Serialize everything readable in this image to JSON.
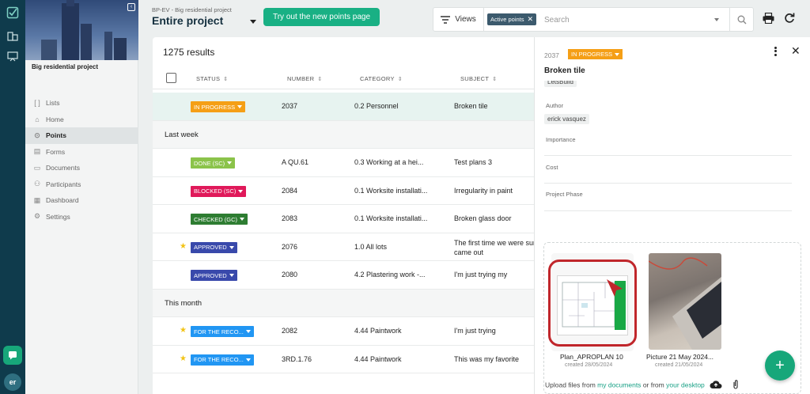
{
  "project": {
    "breadcrumb": "BP-EV - Big residential project",
    "title": "Entire project",
    "sidebar_name": "Big residential project"
  },
  "try_button": "Try out the new points page",
  "toolbar": {
    "views_label": "Views",
    "active_chip": "Active points",
    "search_placeholder": "Search"
  },
  "nav": [
    {
      "label": "Lists",
      "icon": "list-icon",
      "active": false
    },
    {
      "label": "Home",
      "icon": "home-icon",
      "active": false
    },
    {
      "label": "Points",
      "icon": "pin-icon",
      "active": true
    },
    {
      "label": "Forms",
      "icon": "form-icon",
      "active": false
    },
    {
      "label": "Documents",
      "icon": "folder-icon",
      "active": false
    },
    {
      "label": "Participants",
      "icon": "people-icon",
      "active": false
    },
    {
      "label": "Dashboard",
      "icon": "dashboard-icon",
      "active": false
    },
    {
      "label": "Settings",
      "icon": "gear-icon",
      "active": false
    }
  ],
  "rail": {
    "avatar_initials": "er"
  },
  "list": {
    "results": "1275 results",
    "headers": {
      "status": "STATUS",
      "number": "NUMBER",
      "category": "CATEGORY",
      "subject": "SUBJECT"
    },
    "rows": [
      {
        "type": "item",
        "selected": true,
        "star": false,
        "status": "IN PROGRESS",
        "color": "#f59f16",
        "number": "2037",
        "category": "0.2 Personnel",
        "subject": "Broken tile"
      },
      {
        "type": "group",
        "label": "Last week"
      },
      {
        "type": "item",
        "star": false,
        "status": "DONE (SC)",
        "color": "#8bc34a",
        "number": "A QU.61",
        "category": "0.3 Working at a hei...",
        "subject": "Test plans 3"
      },
      {
        "type": "item",
        "star": false,
        "status": "BLOCKED (SC)",
        "color": "#e0195a",
        "number": "2084",
        "category": "0.1 Worksite installati...",
        "subject": "Irregularity in paint"
      },
      {
        "type": "item",
        "star": false,
        "status": "CHECKED (GC)",
        "color": "#2e7d32",
        "number": "2083",
        "category": "0.1 Worksite installati...",
        "subject": "Broken glass door"
      },
      {
        "type": "item",
        "star": true,
        "status": "APPROVED",
        "color": "#3949ab",
        "number": "2076",
        "category": "1.0 All lots",
        "subject": "The first time we were sun came out"
      },
      {
        "type": "item",
        "star": false,
        "status": "APPROVED",
        "color": "#3949ab",
        "number": "2080",
        "category": "4.2 Plastering work -...",
        "subject": "I'm just trying my"
      },
      {
        "type": "group",
        "label": "This month"
      },
      {
        "type": "item",
        "star": true,
        "status": "FOR THE RECO...",
        "color": "#2196f3",
        "number": "2082",
        "category": "4.44 Paintwork",
        "subject": "I'm just trying"
      },
      {
        "type": "item",
        "star": true,
        "status": "FOR THE RECO...",
        "color": "#2196f3",
        "number": "3RD.1.76",
        "category": "4.44 Paintwork",
        "subject": "This was my favorite"
      }
    ]
  },
  "detail": {
    "number": "2037",
    "status": "IN PROGRESS",
    "title": "Broken tile",
    "company_pill": "LetsBuild",
    "author_label": "Author",
    "author": "erick vasquez",
    "importance_label": "Importance",
    "cost_label": "Cost",
    "phase_label": "Project Phase",
    "files": [
      {
        "name": "Plan_APROPLAN 10",
        "date": "created 28/05/2024"
      },
      {
        "name": "Picture 21 May 2024...",
        "date": "created 21/05/2024"
      }
    ],
    "upload_prefix": "Upload files from",
    "upload_link1": "my documents",
    "upload_mid": "or from",
    "upload_link2": "your desktop"
  }
}
